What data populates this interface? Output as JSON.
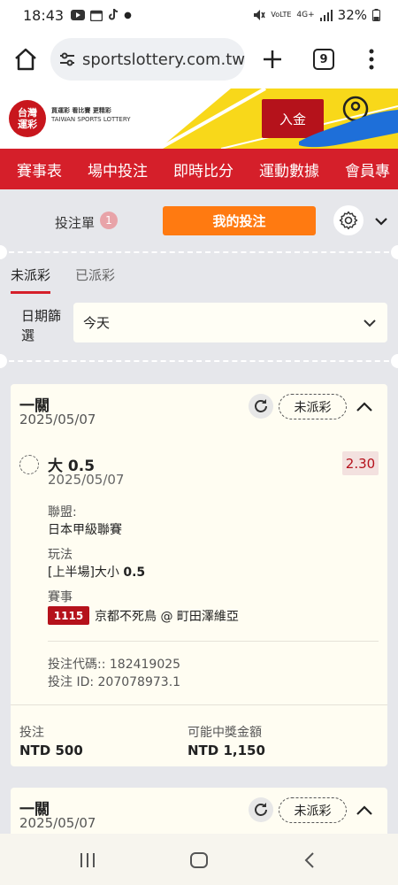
{
  "status_bar": {
    "time": "18:43",
    "battery": "32%",
    "network": "4G+"
  },
  "browser": {
    "url": "sportslottery.com.tw",
    "tab_count": "9"
  },
  "brand": {
    "logo_text": "台灣\n運彩",
    "tagline": "買運彩 看比賽 更精彩",
    "tagline_en": "TAIWAN SPORTS LOTTERY",
    "deposit_label": "入金"
  },
  "nav": {
    "items": [
      "賽事表",
      "場中投注",
      "即時比分",
      "運動數據",
      "會員專"
    ]
  },
  "betslip": {
    "label": "投注單",
    "count": "1",
    "my_bets_label": "我的投注"
  },
  "subtabs": {
    "unsettled": "未派彩",
    "settled": "已派彩"
  },
  "date_filter": {
    "label": "日期篩選",
    "value": "今天"
  },
  "cards": [
    {
      "type": "一關",
      "date": "2025/05/07",
      "status": "未派彩",
      "selection": "大 0.5",
      "selection_date": "2025/05/07",
      "odds": "2.30",
      "league_label": "聯盟:",
      "league": "日本甲級聯賽",
      "market_label": "玩法",
      "market_prefix": "[上半場]大小 ",
      "market_value": "0.5",
      "event_label": "賽事",
      "match_no": "1115",
      "match": "京都不死鳥 @ 町田澤維亞",
      "bet_code": "投注代碼:: 182419025",
      "bet_id": "投注 ID: 207078973.1",
      "stake_label": "投注",
      "stake": "NTD 500",
      "payout_label": "可能中獎金額",
      "payout": "NTD 1,150"
    },
    {
      "type": "一關",
      "date": "2025/05/07",
      "status": "未派彩"
    }
  ],
  "colors": {
    "brand_red": "#d51f2a",
    "accent_orange": "#ff7a11",
    "odds_red": "#b5121b",
    "banner_yellow": "#f8d81a"
  }
}
